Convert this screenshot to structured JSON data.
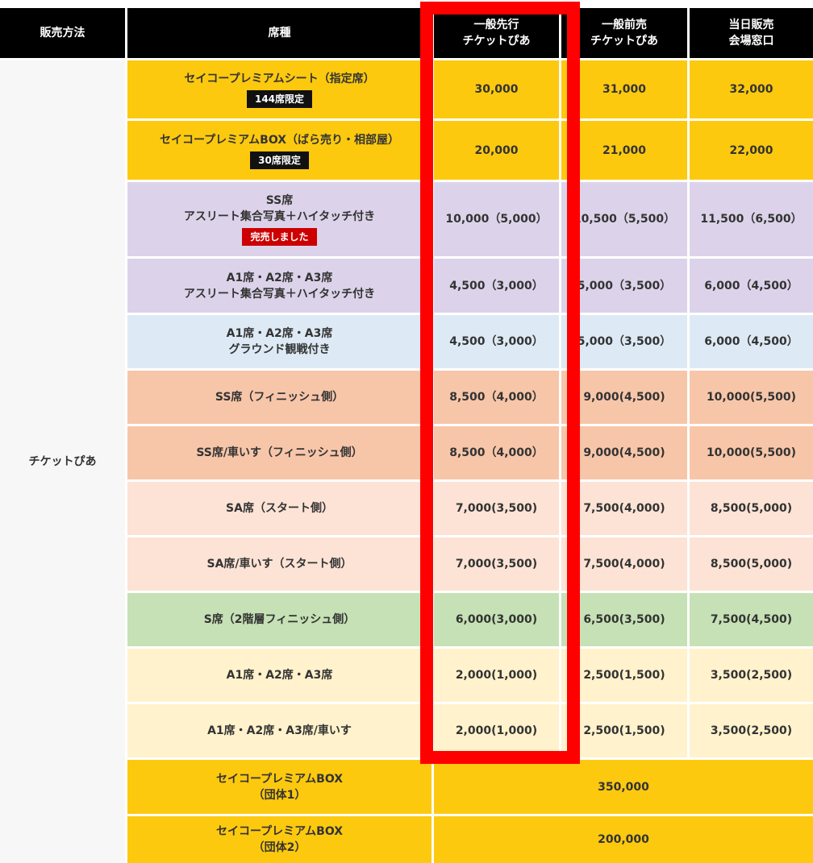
{
  "headers": {
    "method": "販売方法",
    "seat": "席種",
    "advance": [
      "一般先行",
      "チケットぴあ"
    ],
    "presale": [
      "一般前売",
      "チケットぴあ"
    ],
    "sameday": [
      "当日販売",
      "会場窓口"
    ]
  },
  "method_label": "チケットぴあ",
  "colors": {
    "header": "#000000",
    "yellow": "#fcc90f",
    "purple": "#dcd3ea",
    "blue": "#ddeaf5",
    "orange": "#f7c6a9",
    "peach": "#fce3d5",
    "green": "#c6e1b5",
    "cream": "#fff2cc",
    "highlight": "#ff0000"
  },
  "rows": [
    {
      "seat": [
        "セイコープレミアムシート（指定席）"
      ],
      "badge": "144席限定",
      "badge_type": "limit",
      "color": "yellow",
      "advance": "30,000",
      "presale": "31,000",
      "sameday": "32,000"
    },
    {
      "seat": [
        "セイコープレミアムBOX（ばら売り・相部屋）"
      ],
      "badge": "30席限定",
      "badge_type": "limit",
      "color": "yellow",
      "advance": "20,000",
      "presale": "21,000",
      "sameday": "22,000"
    },
    {
      "seat": [
        "SS席",
        "アスリート集合写真＋ハイタッチ付き"
      ],
      "badge": "完売しました",
      "badge_type": "sold",
      "color": "purple",
      "advance": "10,000（5,000）",
      "presale": "10,500（5,500）",
      "sameday": "11,500（6,500）"
    },
    {
      "seat": [
        "A1席・A2席・A3席",
        "アスリート集合写真＋ハイタッチ付き"
      ],
      "color": "purple",
      "advance": "4,500（3,000）",
      "presale": "5,000（3,500）",
      "sameday": "6,000（4,500）"
    },
    {
      "seat": [
        "A1席・A2席・A3席",
        "グラウンド観戦付き"
      ],
      "color": "blue",
      "advance": "4,500（3,000）",
      "presale": "5,000（3,500）",
      "sameday": "6,000（4,500）"
    },
    {
      "seat": [
        "SS席（フィニッシュ側）"
      ],
      "color": "orange",
      "advance": "8,500（4,000）",
      "presale": "9,000(4,500)",
      "sameday": "10,000(5,500)"
    },
    {
      "seat": [
        "SS席/車いす（フィニッシュ側）"
      ],
      "color": "orange",
      "advance": "8,500（4,000）",
      "presale": "9,000(4,500)",
      "sameday": "10,000(5,500)"
    },
    {
      "seat": [
        "SA席（スタート側）"
      ],
      "color": "peach",
      "advance": "7,000(3,500)",
      "presale": "7,500(4,000)",
      "sameday": "8,500(5,000)"
    },
    {
      "seat": [
        "SA席/車いす（スタート側）"
      ],
      "color": "peach",
      "advance": "7,000(3,500)",
      "presale": "7,500(4,000)",
      "sameday": "8,500(5,000)"
    },
    {
      "seat": [
        "S席（2階層フィニッシュ側）"
      ],
      "color": "green",
      "advance": "6,000(3,000)",
      "presale": "6,500(3,500)",
      "sameday": "7,500(4,500)"
    },
    {
      "seat": [
        "A1席・A2席・A3席"
      ],
      "color": "cream",
      "advance": "2,000(1,000)",
      "presale": "2,500(1,500)",
      "sameday": "3,500(2,500)"
    },
    {
      "seat": [
        "A1席・A2席・A3席/車いす"
      ],
      "color": "cream",
      "advance": "2,000(1,000)",
      "presale": "2,500(1,500)",
      "sameday": "3,500(2,500)"
    },
    {
      "seat": [
        "セイコープレミアムBOX",
        "（団体1）"
      ],
      "color": "yellow",
      "merged": "350,000"
    },
    {
      "seat": [
        "セイコープレミアムBOX",
        "（団体2）"
      ],
      "color": "yellow",
      "merged": "200,000"
    }
  ]
}
